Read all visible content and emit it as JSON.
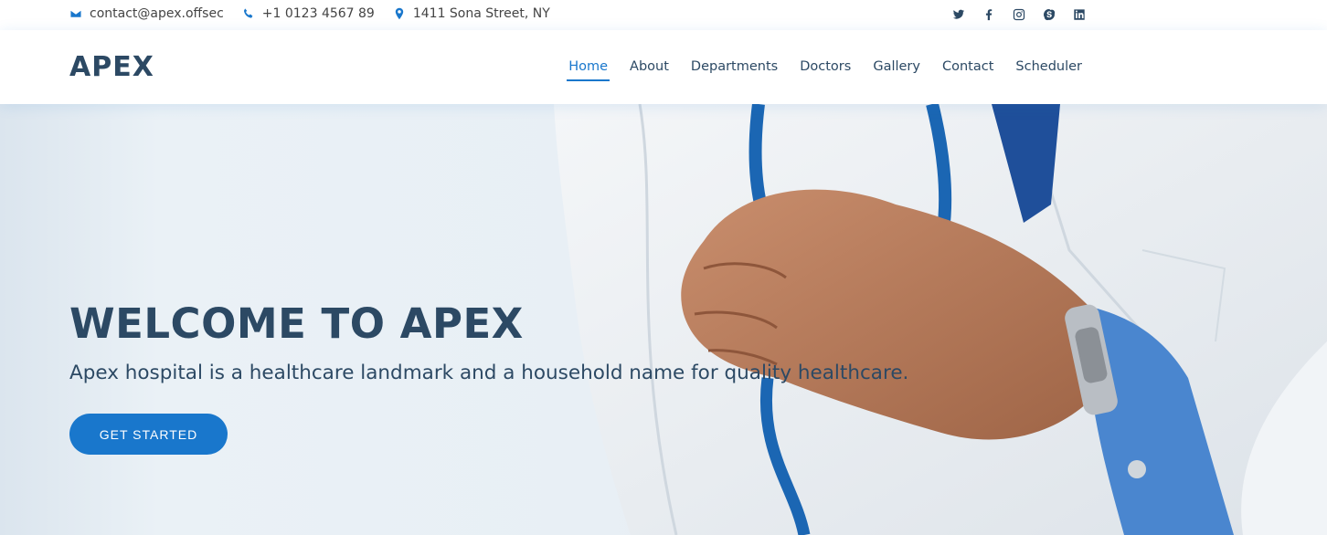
{
  "topbar": {
    "email": "contact@apex.offsec",
    "phone": "+1 0123 4567 89",
    "address": "1411 Sona Street, NY",
    "social_icons": [
      "twitter-icon",
      "facebook-icon",
      "instagram-icon",
      "skype-icon",
      "linkedin-icon"
    ]
  },
  "header": {
    "logo": "APEX",
    "nav": [
      "Home",
      "About",
      "Departments",
      "Doctors",
      "Gallery",
      "Contact",
      "Scheduler"
    ],
    "active_nav": "Home"
  },
  "hero": {
    "title": "WELCOME TO APEX",
    "subtitle": "Apex hospital is a healthcare landmark and a household name for quality healthcare.",
    "cta_label": "GET STARTED"
  },
  "colors": {
    "accent": "#1977cc",
    "heading": "#2c4964"
  }
}
